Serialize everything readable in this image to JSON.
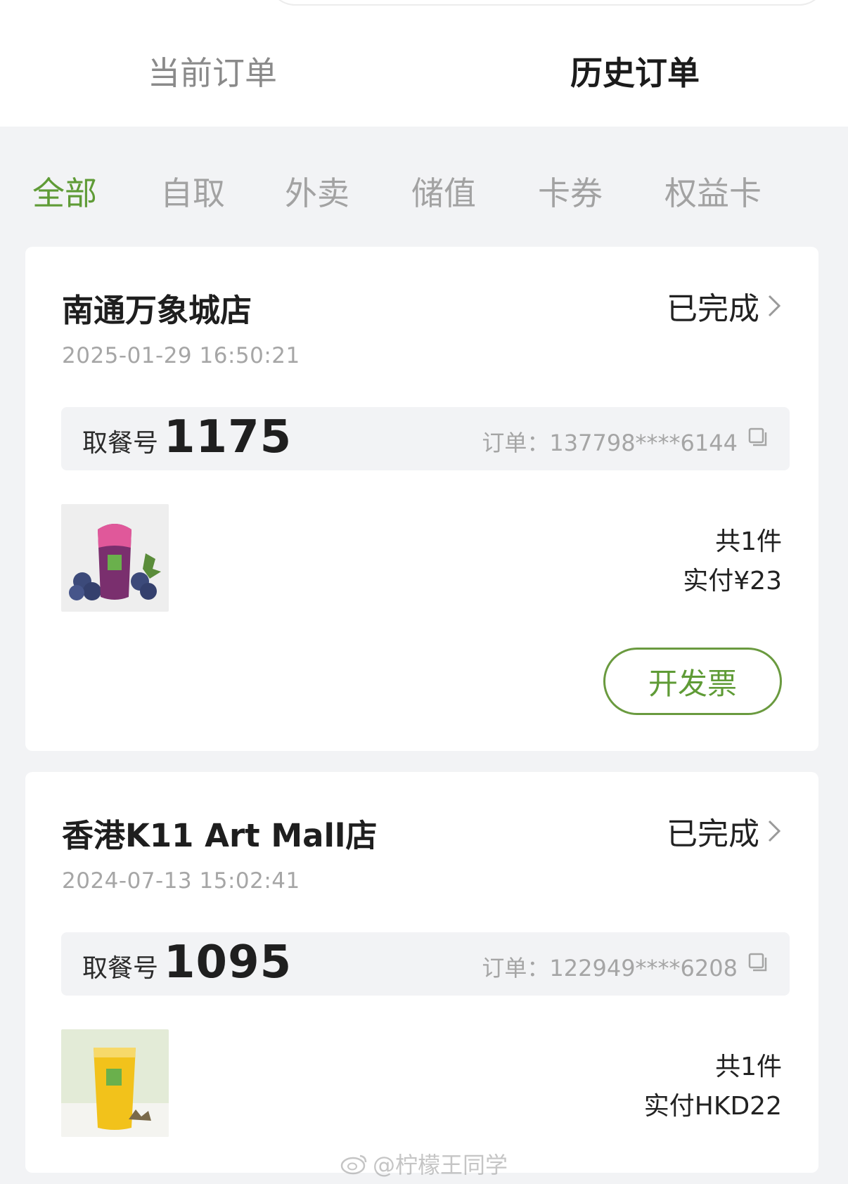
{
  "main_tabs": {
    "current": "当前订单",
    "history": "历史订单"
  },
  "filter_tabs": [
    "全部",
    "自取",
    "外卖",
    "储值",
    "卡券",
    "权益卡"
  ],
  "orders": [
    {
      "store": "南通万象城店",
      "status": "已完成",
      "time": "2025-01-29 16:50:21",
      "pickup_label": "取餐号",
      "pickup_number": "1175",
      "order_no": "订单：137798****6144",
      "count": "共1件",
      "paid": "实付¥23",
      "invoice": "开发票",
      "thumb_colors": {
        "drink": "#7a2f6e",
        "top": "#e0589a",
        "fruit": "#3c4a7a"
      }
    },
    {
      "store": "香港K11 Art Mall店",
      "status": "已完成",
      "time": "2024-07-13 15:02:41",
      "pickup_label": "取餐号",
      "pickup_number": "1095",
      "order_no": "订单：122949****6208",
      "count": "共1件",
      "paid": "实付HKD22",
      "thumb_colors": {
        "drink": "#f2c21b",
        "bg": "#e3ebd7"
      }
    }
  ],
  "watermark": "@柠檬王同学",
  "colors": {
    "accent": "#5f9b36",
    "background": "#f2f3f5"
  }
}
